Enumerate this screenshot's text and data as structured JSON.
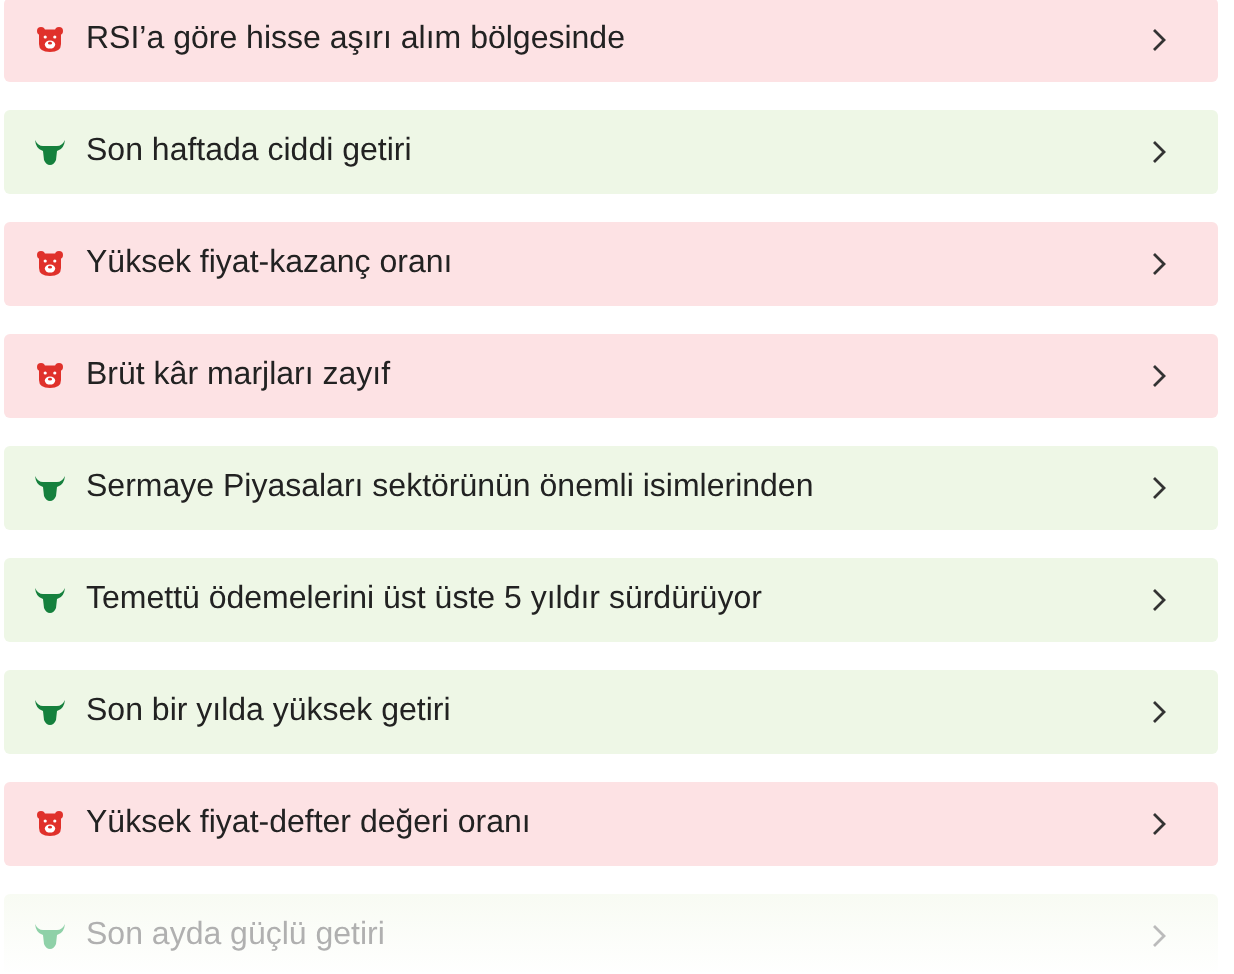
{
  "signals": [
    {
      "kind": "bear",
      "text": "RSI’a göre hisse aşırı alım bölgesinde",
      "faded": false
    },
    {
      "kind": "bull",
      "text": "Son haftada ciddi getiri",
      "faded": false
    },
    {
      "kind": "bear",
      "text": "Yüksek fiyat-kazanç oranı",
      "faded": false
    },
    {
      "kind": "bear",
      "text": "Brüt kâr marjları zayıf",
      "faded": false
    },
    {
      "kind": "bull",
      "text": "Sermaye Piyasaları sektörünün önemli isimlerinden",
      "faded": false
    },
    {
      "kind": "bull",
      "text": "Temettü ödemelerini üst üste 5 yıldır sürdürüyor",
      "faded": false
    },
    {
      "kind": "bull",
      "text": "Son bir yılda yüksek getiri",
      "faded": false
    },
    {
      "kind": "bear",
      "text": "Yüksek fiyat-defter değeri oranı",
      "faded": false
    },
    {
      "kind": "bull",
      "text": "Son ayda güçlü getiri",
      "faded": true
    }
  ]
}
